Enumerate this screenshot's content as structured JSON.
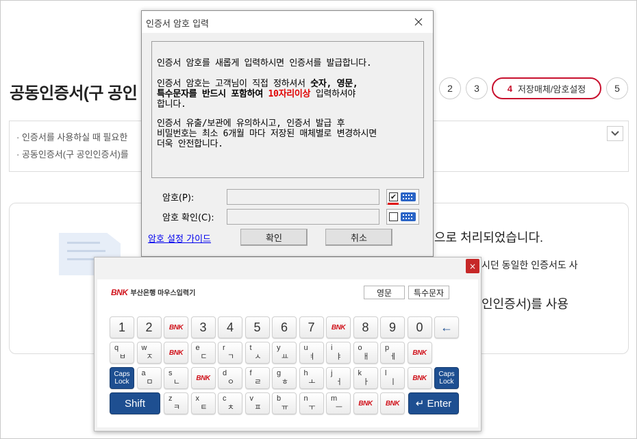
{
  "page": {
    "title": "공동인증서(구 공인",
    "steps": [
      "2",
      "3"
    ],
    "active_step": {
      "num": "4",
      "label": "저장매체/암호설정"
    },
    "last_step": "5",
    "notices": [
      "· 인증서를 사용하실 때 필요한",
      "· 공동인증서(구 공인인증서)를"
    ],
    "content_lines": [
      "으로 처리되었습니다.",
      "시던 동일한 인증서도 사",
      "인인증서)를 사용"
    ]
  },
  "dialog": {
    "title": "인증서 암호 입력",
    "para1": "인증서 암호를 새롭게 입력하시면 인증서를 발급합니다.",
    "para2_line1_plain": "인증서 암호는 고객님이 직접 정하셔서 ",
    "para2_line1_bold": "숫자, 영문,",
    "para2_line2_bold": "특수문자를 반드시 포함하여 ",
    "para2_line2_red": "10자리이상",
    "para2_line2_plain": " 입력하셔야",
    "para2_line3": "합니다.",
    "para3_lines": [
      "인증서 유출/보관에 유의하시고, 인증서 발급 후",
      "비밀번호는 최소 6개월 마다 저장된 매체별로 변경하시면",
      "더욱 안전합니다."
    ],
    "password_label": "암호(P):",
    "confirm_label": "암호 확인(C):",
    "password_value": "",
    "confirm_value": "",
    "checkbox1_checked": true,
    "checkbox2_checked": false,
    "guide_link": "암호 설정 가이드",
    "ok_button": "확인",
    "cancel_button": "취소"
  },
  "keyboard": {
    "brand_logo": "BNK",
    "brand_name": "부산은행 마우스입력기",
    "toggle_english": "영문",
    "toggle_special": "특수문자",
    "close_symbol": "×",
    "logo_key": "BNK",
    "row1": [
      "1",
      "2",
      "BNK",
      "3",
      "4",
      "5",
      "6",
      "7",
      "BNK",
      "8",
      "9",
      "0",
      "←"
    ],
    "row2": [
      [
        "q",
        "ㅂ"
      ],
      [
        "w",
        "ㅈ"
      ],
      "BNK",
      [
        "e",
        "ㄷ"
      ],
      [
        "r",
        "ㄱ"
      ],
      [
        "t",
        "ㅅ"
      ],
      [
        "y",
        "ㅛ"
      ],
      [
        "u",
        "ㅕ"
      ],
      [
        "i",
        "ㅑ"
      ],
      [
        "o",
        "ㅐ"
      ],
      [
        "p",
        "ㅔ"
      ],
      "BNK"
    ],
    "row3_caps": "Caps Lock",
    "row3": [
      [
        "a",
        "ㅁ"
      ],
      [
        "s",
        "ㄴ"
      ],
      "BNK",
      [
        "d",
        "ㅇ"
      ],
      [
        "f",
        "ㄹ"
      ],
      [
        "g",
        "ㅎ"
      ],
      [
        "h",
        "ㅗ"
      ],
      [
        "j",
        "ㅓ"
      ],
      [
        "k",
        "ㅏ"
      ],
      [
        "l",
        "ㅣ"
      ],
      "BNK"
    ],
    "shift": "Shift",
    "row4": [
      [
        "z",
        "ㅋ"
      ],
      [
        "x",
        "ㅌ"
      ],
      [
        "c",
        "ㅊ"
      ],
      [
        "v",
        "ㅍ"
      ],
      [
        "b",
        "ㅠ"
      ],
      [
        "n",
        "ㅜ"
      ],
      [
        "m",
        "ㅡ"
      ],
      "BNK",
      "BNK"
    ],
    "enter": "↵ Enter"
  }
}
